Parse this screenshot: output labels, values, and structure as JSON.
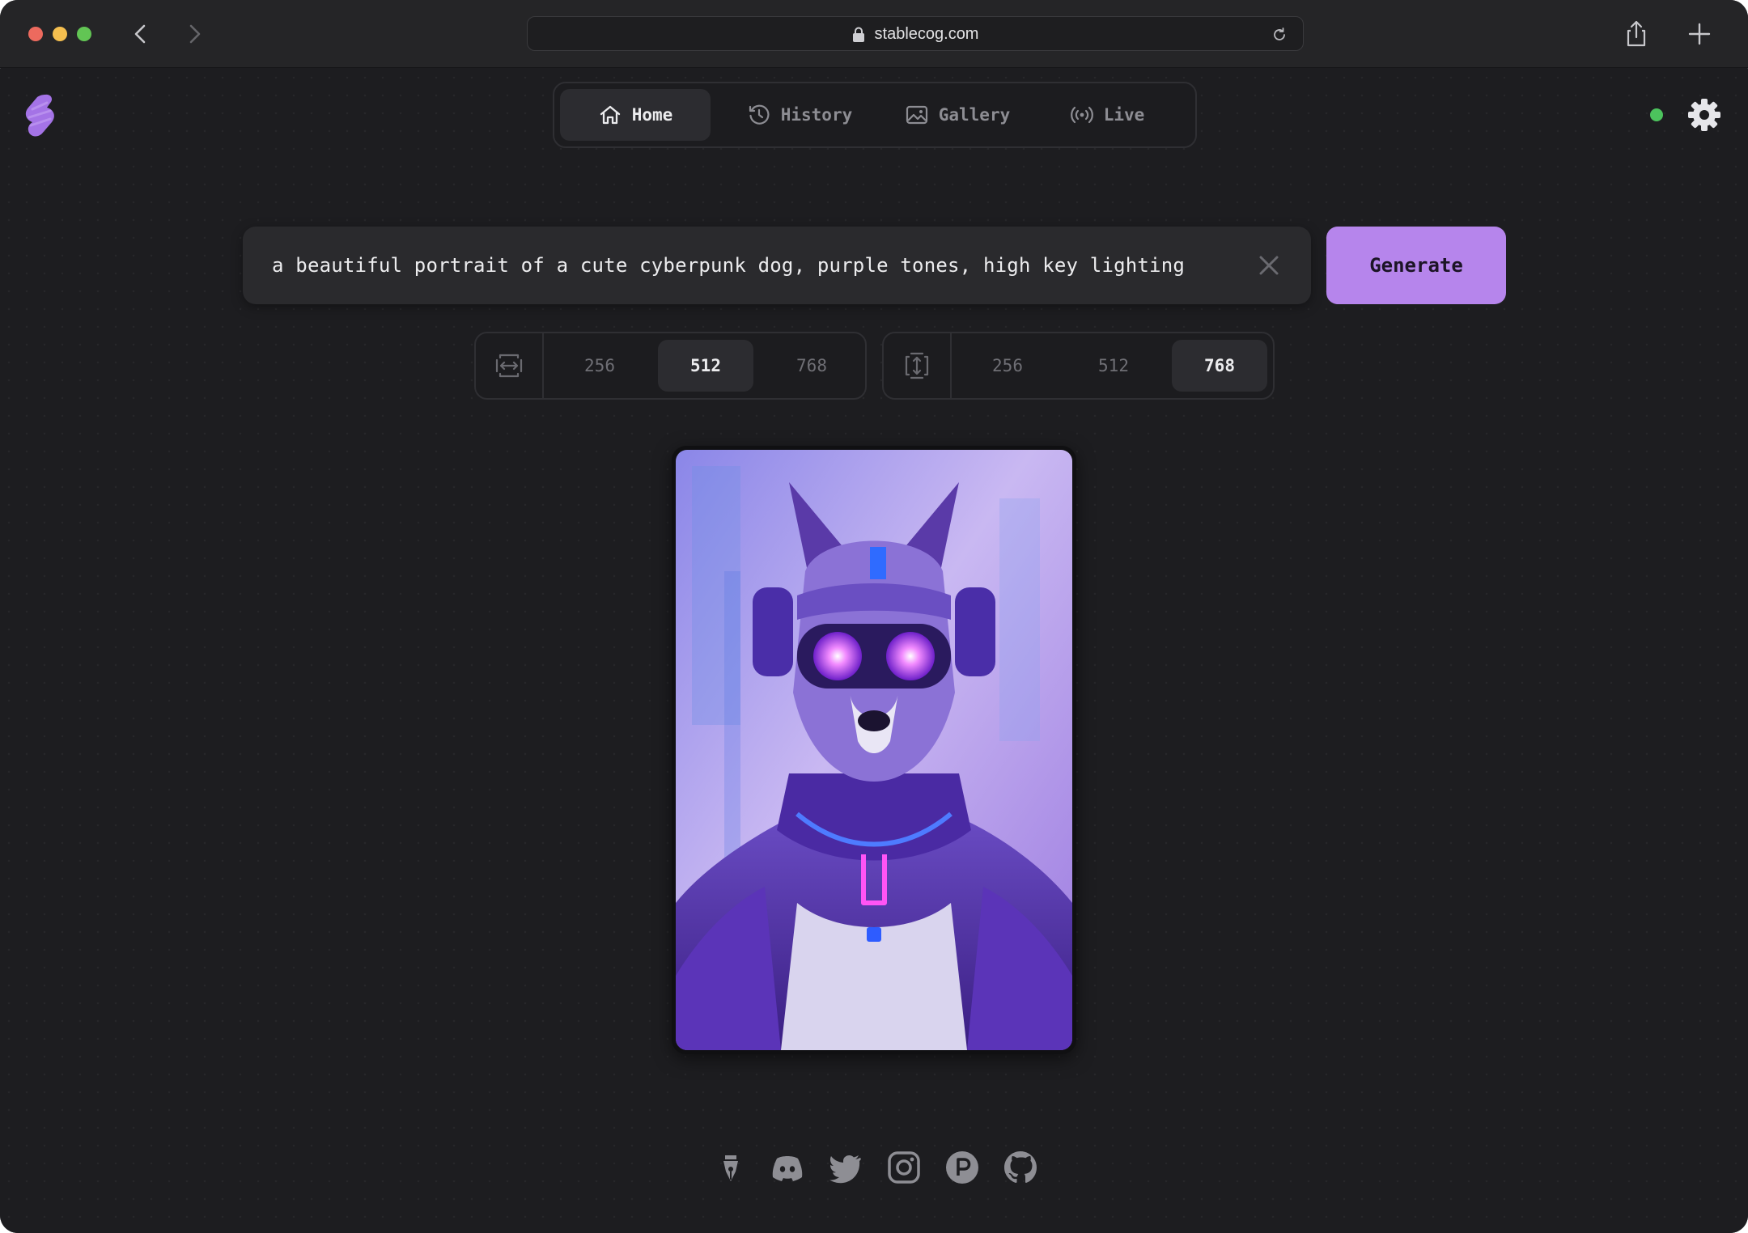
{
  "browser": {
    "url": "stablecog.com"
  },
  "nav": {
    "tabs": [
      {
        "label": "Home",
        "icon": "home-icon",
        "active": true
      },
      {
        "label": "History",
        "icon": "history-icon",
        "active": false
      },
      {
        "label": "Gallery",
        "icon": "gallery-icon",
        "active": false
      },
      {
        "label": "Live",
        "icon": "live-icon",
        "active": false
      }
    ]
  },
  "status": {
    "online": true,
    "color": "#4cc35d"
  },
  "prompt": {
    "value": "a beautiful portrait of a cute cyberpunk dog, purple tones, high key lighting"
  },
  "generate": {
    "label": "Generate",
    "color": "#b685ec"
  },
  "width": {
    "icon": "width-icon",
    "options": [
      "256",
      "512",
      "768"
    ],
    "selected": "512"
  },
  "height": {
    "icon": "height-icon",
    "options": [
      "256",
      "512",
      "768"
    ],
    "selected": "768"
  },
  "result_image": {
    "subject": "cyberpunk dog portrait, purple tones"
  },
  "footer": {
    "links": [
      "blog-icon",
      "discord-icon",
      "twitter-icon",
      "instagram-icon",
      "producthunt-icon",
      "github-icon"
    ]
  }
}
